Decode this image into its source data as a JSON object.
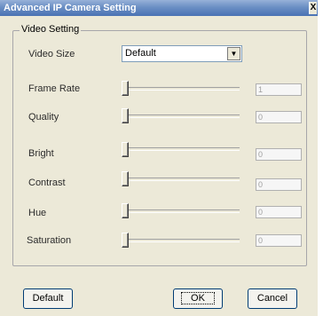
{
  "window": {
    "title": "Advanced IP Camera Setting",
    "close_glyph": "X"
  },
  "group": {
    "title": "Video Setting"
  },
  "video_size": {
    "label": "Video Size",
    "value": "Default"
  },
  "sliders": [
    {
      "label": "Frame Rate",
      "value": "1",
      "level": 0
    },
    {
      "label": "Quality",
      "value": "0",
      "level": 0
    },
    {
      "label": "Bright",
      "value": "0",
      "level": 0
    },
    {
      "label": "Contrast",
      "value": "0",
      "level": 0
    },
    {
      "label": "Hue",
      "value": "0",
      "level": 0
    },
    {
      "label": "Saturation",
      "value": "0",
      "level": 0
    }
  ],
  "buttons": {
    "default_label": "Default",
    "ok_label": "OK",
    "cancel_label": "Cancel"
  }
}
